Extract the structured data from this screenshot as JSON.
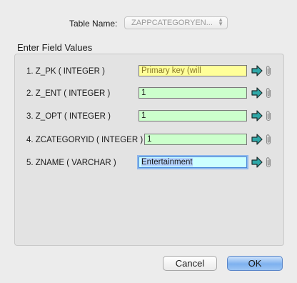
{
  "table": {
    "label": "Table Name:",
    "value": "ZAPPCATEGORYEN..."
  },
  "group": {
    "title": "Enter Field Values"
  },
  "fields": [
    {
      "label": "1. Z_PK ( INTEGER )",
      "value": "Primary key (will",
      "color": "#ffff99"
    },
    {
      "label": "2. Z_ENT ( INTEGER )",
      "value": "1",
      "color": "#ccffcc"
    },
    {
      "label": "3. Z_OPT ( INTEGER )",
      "value": "1",
      "color": "#ccffcc"
    },
    {
      "label": "4. ZCATEGORYID ( INTEGER )",
      "value": "1",
      "color": "#ccffcc"
    },
    {
      "label": "5. ZNAME ( VARCHAR )",
      "value": "Entertainment",
      "color": "#ccffff"
    }
  ],
  "buttons": {
    "cancel": "Cancel",
    "ok": "OK"
  },
  "icons": {
    "arrow": "arrow-right-icon",
    "attach": "paperclip-icon"
  },
  "colors": {
    "arrow_fill": "#2fa8a8",
    "selection": "#b5d4ff",
    "focus_ring": "#4a89d9"
  }
}
